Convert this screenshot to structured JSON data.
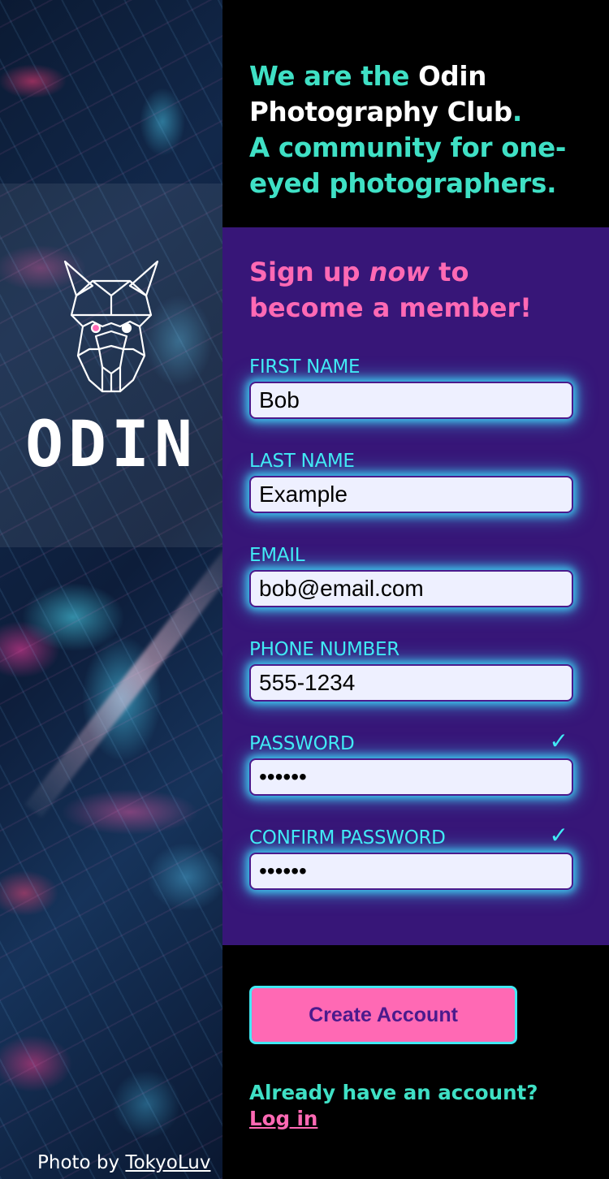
{
  "hero": {
    "line1_prefix": "We are the ",
    "club_name": "Odin Photography Club",
    "period": ".",
    "tagline": "A community for one-eyed photographers."
  },
  "signup": {
    "heading_part1": "Sign up ",
    "heading_emphasis": "now",
    "heading_part2": " to become a member!"
  },
  "fields": {
    "first_name": {
      "label": "FIRST NAME",
      "value": "Bob"
    },
    "last_name": {
      "label": "LAST NAME",
      "value": "Example"
    },
    "email": {
      "label": "EMAIL",
      "value": "bob@email.com"
    },
    "phone": {
      "label": "PHONE NUMBER",
      "value": "555-1234"
    },
    "password": {
      "label": "PASSWORD",
      "value": "••••••",
      "valid_mark": "✓"
    },
    "confirm_password": {
      "label": "CONFIRM PASSWORD",
      "value": "••••••",
      "valid_mark": "✓"
    }
  },
  "actions": {
    "create_label": "Create Account",
    "login_prompt": "Already have an account?",
    "login_link": "Log in"
  },
  "branding": {
    "logo_word": "ODIN",
    "credit_prefix": "Photo by ",
    "credit_author": "TokyoLuv"
  },
  "colors": {
    "accent_teal": "#3fe0c5",
    "accent_cyan": "#41eaf5",
    "accent_pink": "#ff69b4",
    "form_bg": "#371678"
  }
}
